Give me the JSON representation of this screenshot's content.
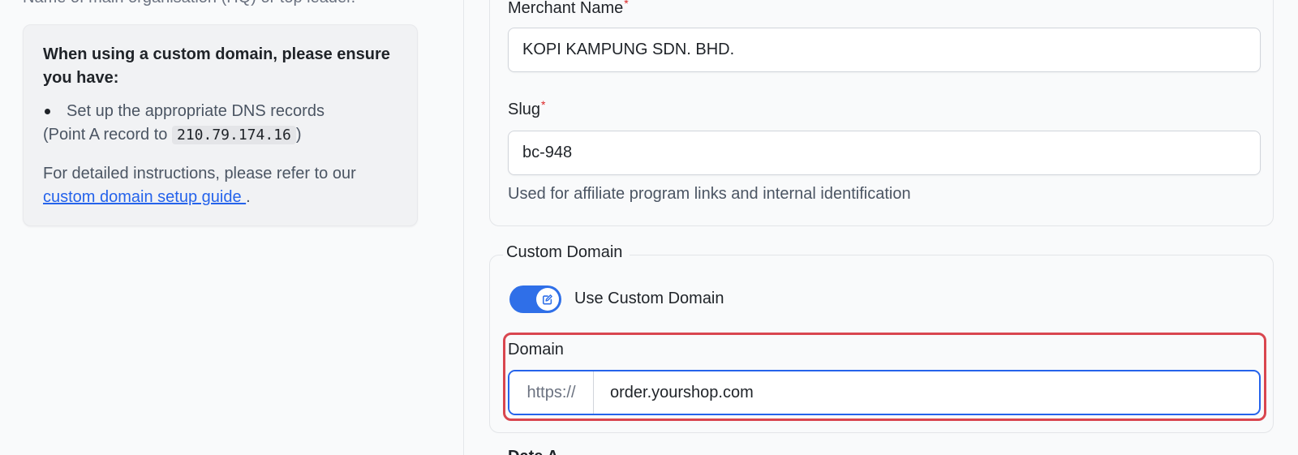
{
  "left": {
    "cut_text": "Name of main organisation (HQ) or top leader.",
    "info_card": {
      "heading": "When using a custom domain, please ensure you have:",
      "bullet_prefix": "Set up the appropriate DNS records",
      "bullet_suffix_before": "(Point A record to ",
      "ip": "210.79.174.16",
      "bullet_suffix_after": ")",
      "para_text": "For detailed instructions, please refer to our",
      "link_text": "custom domain setup guide ",
      "para_end": "."
    }
  },
  "form": {
    "merchant_name": {
      "label": "Merchant Name",
      "required_mark": "*",
      "value": "KOPI KAMPUNG SDN. BHD."
    },
    "slug": {
      "label": "Slug",
      "required_mark": "*",
      "value": "bc-948",
      "help": "Used for affiliate program links and internal identification"
    },
    "custom_domain": {
      "legend": "Custom Domain",
      "toggle_label": "Use Custom Domain",
      "toggle_on": true,
      "domain_label": "Domain",
      "prefix": "https://",
      "value": "order.yourshop.com"
    },
    "next_label_cut": "Date A"
  },
  "colors": {
    "accent": "#2563eb",
    "toggle": "#2f6fe8",
    "required": "#dc2626",
    "highlight": "#d9464f"
  },
  "icons": {
    "toggle_knob": "edit-icon"
  }
}
